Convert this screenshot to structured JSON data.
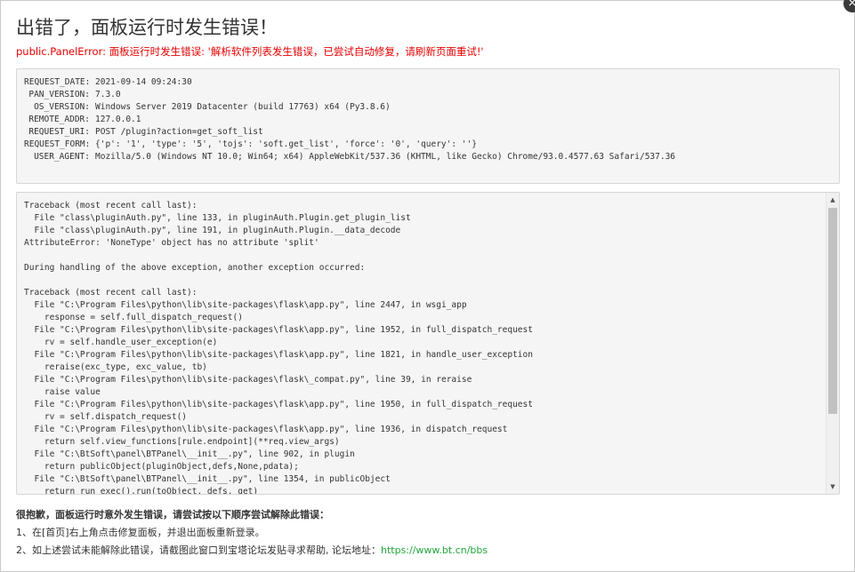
{
  "dialog": {
    "title": "出错了，面板运行时发生错误！",
    "error_message": "public.PanelError: 面板运行时发生错误: '解析软件列表发生错误，已尝试自动修复，请刷新页面重试!'",
    "close_icon": "×"
  },
  "request_info": [
    {
      "key": "REQUEST_DATE:",
      "value": "2021-09-14 09:24:30"
    },
    {
      "key": "PAN_VERSION:",
      "value": "7.3.0"
    },
    {
      "key": "OS_VERSION:",
      "value": "Windows Server 2019 Datacenter (build 17763) x64 (Py3.8.6)"
    },
    {
      "key": "REMOTE_ADDR:",
      "value": "127.0.0.1"
    },
    {
      "key": "REQUEST_URI:",
      "value": "POST /plugin?action=get_soft_list"
    },
    {
      "key": "REQUEST_FORM:",
      "value": "{'p': '1', 'type': '5', 'tojs': 'soft.get_list', 'force': '0', 'query': ''}"
    },
    {
      "key": "USER_AGENT:",
      "value": "Mozilla/5.0 (Windows NT 10.0; Win64; x64) AppleWebKit/537.36 (KHTML, like Gecko) Chrome/93.0.4577.63 Safari/537.36"
    }
  ],
  "traceback": [
    "Traceback (most recent call last):",
    "  File \"class\\pluginAuth.py\", line 133, in pluginAuth.Plugin.get_plugin_list",
    "  File \"class\\pluginAuth.py\", line 191, in pluginAuth.Plugin.__data_decode",
    "AttributeError: 'NoneType' object has no attribute 'split'",
    "",
    "During handling of the above exception, another exception occurred:",
    "",
    "Traceback (most recent call last):",
    "  File \"C:\\Program Files\\python\\lib\\site-packages\\flask\\app.py\", line 2447, in wsgi_app",
    "    response = self.full_dispatch_request()",
    "  File \"C:\\Program Files\\python\\lib\\site-packages\\flask\\app.py\", line 1952, in full_dispatch_request",
    "    rv = self.handle_user_exception(e)",
    "  File \"C:\\Program Files\\python\\lib\\site-packages\\flask\\app.py\", line 1821, in handle_user_exception",
    "    reraise(exc_type, exc_value, tb)",
    "  File \"C:\\Program Files\\python\\lib\\site-packages\\flask\\_compat.py\", line 39, in reraise",
    "    raise value",
    "  File \"C:\\Program Files\\python\\lib\\site-packages\\flask\\app.py\", line 1950, in full_dispatch_request",
    "    rv = self.dispatch_request()",
    "  File \"C:\\Program Files\\python\\lib\\site-packages\\flask\\app.py\", line 1936, in dispatch_request",
    "    return self.view_functions[rule.endpoint](**req.view_args)",
    "  File \"C:\\BtSoft\\panel\\BTPanel\\__init__.py\", line 902, in plugin",
    "    return publicObject(pluginObject,defs,None,pdata);",
    "  File \"C:\\BtSoft\\panel\\BTPanel\\__init__.py\", line 1354, in publicObject",
    "    return run_exec().run(toObject, defs, get)"
  ],
  "scrollbar": {
    "up_icon": "▲",
    "down_icon": "▼"
  },
  "help": {
    "title": "很抱歉，面板运行时意外发生错误，请尝试按以下顺序尝试解除此错误：",
    "step1": "1、在[首页]右上角点击修复面板，并退出面板重新登录。",
    "step2_prefix": "2、如上述尝试未能解除此错误，请截图此窗口到宝塔论坛发贴寻求帮助, 论坛地址：",
    "forum_url": "https://www.bt.cn/bbs"
  }
}
